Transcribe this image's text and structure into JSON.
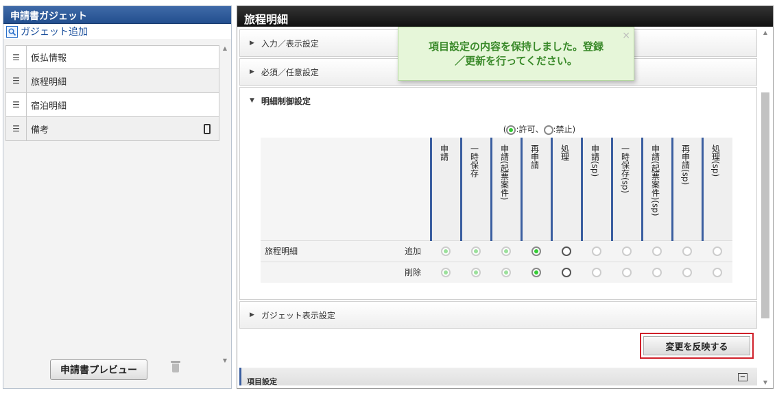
{
  "left": {
    "title": "申請書ガジェット",
    "add_label": "ガジェット追加",
    "items": [
      {
        "label": "仮払情報",
        "mobile": false
      },
      {
        "label": "旅程明細",
        "mobile": false
      },
      {
        "label": "宿泊明細",
        "mobile": false
      },
      {
        "label": "備考",
        "mobile": true
      }
    ],
    "preview_label": "申請書プレビュー"
  },
  "right": {
    "title": "旅程明細",
    "sections": {
      "input_display": "入力／表示設定",
      "required": "必須／任意設定",
      "detail_control": "明細制御設定",
      "gadget_display": "ガジェット表示設定"
    },
    "legend": {
      "open": "(",
      "allow": ":許可、",
      "deny": ":禁止)"
    },
    "columns": [
      "申請",
      "一時保存",
      "申請(起票案件)",
      "再申請",
      "処理",
      "申請(sp)",
      "一時保存(sp)",
      "申請(起票案件)(sp)",
      "再申請(sp)",
      "処理(sp)"
    ],
    "rows": [
      {
        "label": "旅程明細",
        "action": "追加",
        "states": [
          "dis-on",
          "dis-on",
          "dis-on",
          "on",
          "dark",
          "dis",
          "dis",
          "dis",
          "dis",
          "dis"
        ]
      },
      {
        "label": "",
        "action": "削除",
        "states": [
          "dis-on",
          "dis-on",
          "dis-on",
          "on",
          "dark",
          "dis",
          "dis",
          "dis",
          "dis",
          "dis"
        ]
      }
    ],
    "apply_label": "変更を反映する",
    "item_settings": "項目設定",
    "minus": "−"
  },
  "toast": {
    "line1": "項目設定の内容を保持しました。登録",
    "line2": "／更新を行ってください。",
    "close": "×"
  },
  "colors": {
    "header_blue": "#234f8f",
    "toast_green": "#3a8a2a",
    "highlight_red": "#d0202a"
  }
}
